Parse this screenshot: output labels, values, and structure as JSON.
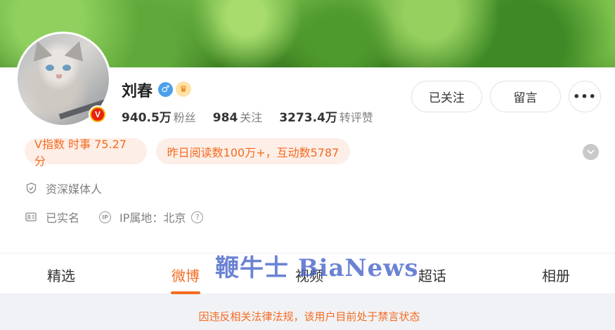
{
  "profile": {
    "name": "刘春",
    "avatar_badge": "V",
    "stats": [
      {
        "value": "940.5万",
        "label": "粉丝"
      },
      {
        "value": "984",
        "label": "关注"
      },
      {
        "value": "3273.4万",
        "label": "转评赞"
      }
    ]
  },
  "actions": {
    "follow_label": "已关注",
    "message_label": "留言",
    "more_label": "•••"
  },
  "highlights": {
    "v_index": "V指数 时事 75.27分",
    "read_stats": "昨日阅读数100万+，互动数5787"
  },
  "info": {
    "certification": "资深媒体人",
    "real_name": "已实名",
    "ip_label": "IP属地：北京",
    "ip_icon_text": "IP",
    "help_text": "?"
  },
  "tabs": [
    {
      "label": "精选"
    },
    {
      "label": "微博",
      "active": true
    },
    {
      "label": "视频"
    },
    {
      "label": "超话"
    },
    {
      "label": "相册"
    }
  ],
  "watermark": "鞭牛士 BiaNews",
  "notice": "因违反相关法律法规，该用户目前处于禁言状态",
  "icons": {
    "gender": "male-icon",
    "member": "crown-icon",
    "certification": "shield-check-icon",
    "real_name": "id-card-icon",
    "expand": "chevron-down-icon"
  },
  "colors": {
    "accent": "#f36c21",
    "pill_bg": "#fdeee7",
    "gender_blue": "#4aa0ea",
    "verified_badge": "#e8210c",
    "watermark": "#4260c8"
  }
}
